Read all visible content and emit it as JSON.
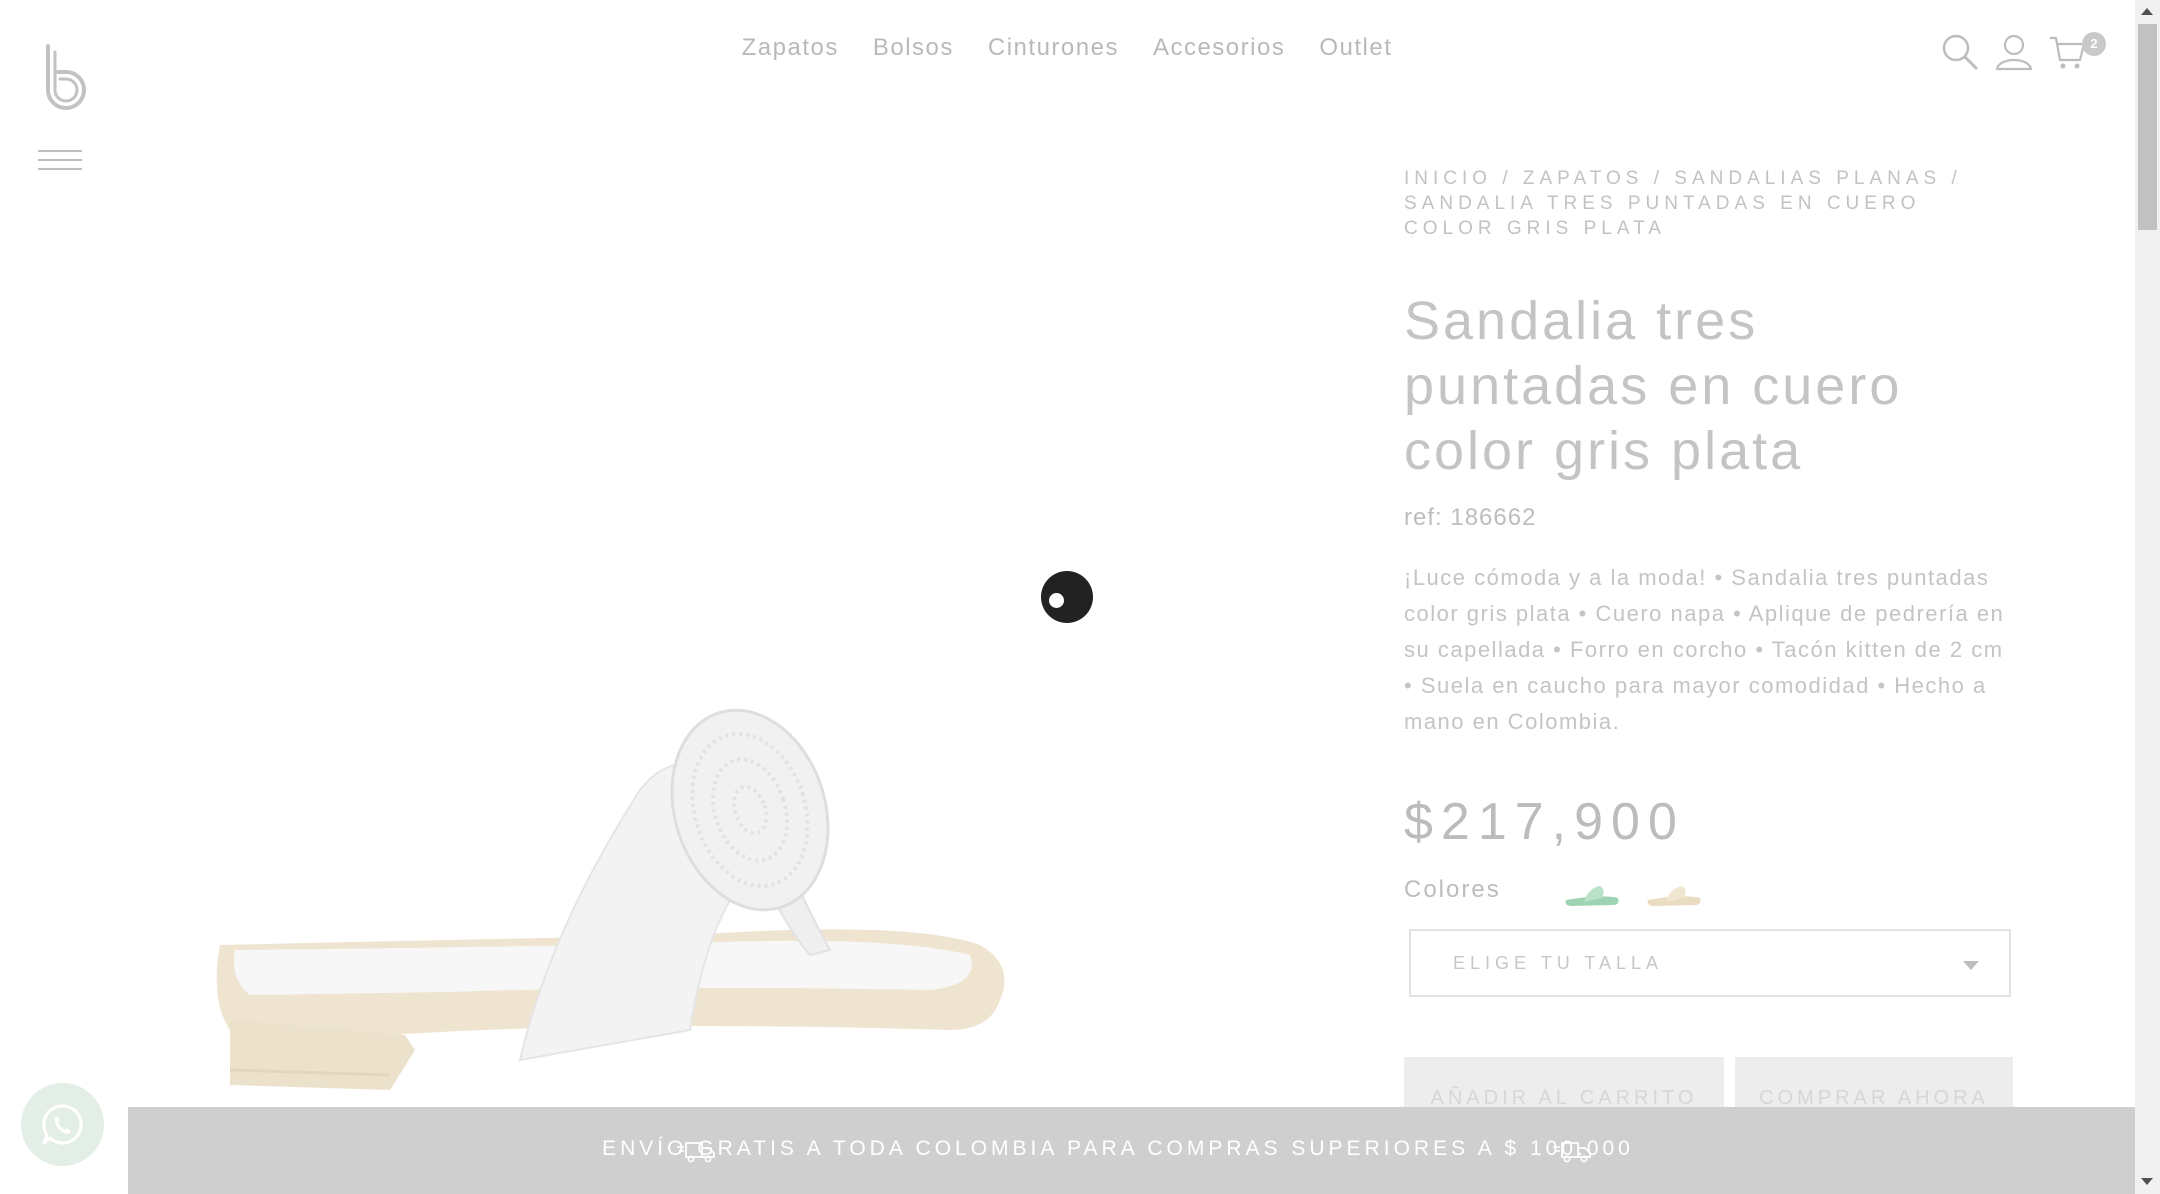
{
  "header": {
    "nav": [
      "Zapatos",
      "Bolsos",
      "Cinturones",
      "Accesorios",
      "Outlet"
    ],
    "cart_count": "2",
    "icons": [
      "search-icon",
      "user-icon",
      "cart-icon",
      "menu-icon"
    ]
  },
  "product": {
    "breadcrumb": [
      "INICIO",
      "ZAPATOS",
      "SANDALIAS PLANAS",
      "SANDALIA TRES PUNTADAS EN CUERO COLOR GRIS PLATA"
    ],
    "breadcrumb_sep": " / ",
    "title": "Sandalia tres puntadas en cuero color gris plata",
    "ref": "ref: 186662",
    "description": "¡Luce cómoda y a la moda! • Sandalia tres puntadas color gris plata • Cuero napa • Aplique de pedrería en su capellada • Forro en corcho • Tacón kitten de 2 cm • Suela en caucho para mayor comodidad • Hecho a mano en Colombia.",
    "price": "$217,900",
    "colors_label": "Colores",
    "swatches": [
      "#9ed4b4",
      "#e9dcc0"
    ],
    "size_placeholder": "ELIGE TU TALLA",
    "add_to_cart": "AÑADIR AL CARRITO",
    "buy_now": "COMPRAR AHORA"
  },
  "banner": {
    "text": "ENVÍO GRATIS A TODA COLOMBIA PARA COMPRAS SUPERIORES A $ 100.000"
  },
  "colors": {
    "text_muted": "#bcbcbc",
    "banner_bg": "#cfcfcf",
    "loader": "#222222"
  }
}
